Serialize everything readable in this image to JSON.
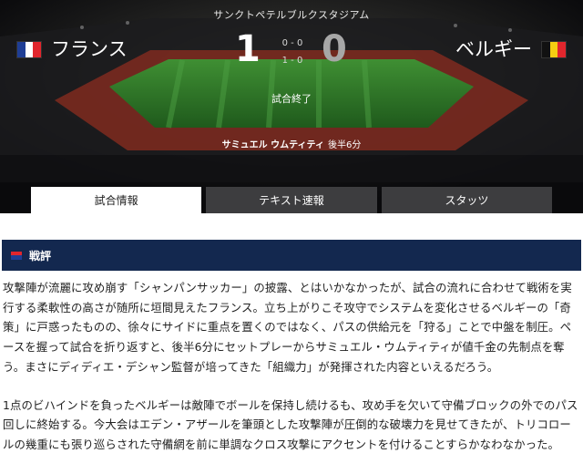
{
  "match": {
    "venue": "サンクトペテルブルクスタジアム",
    "home": {
      "name": "フランス",
      "score": "1",
      "flag_colors": [
        "#1f3e95",
        "#ffffff",
        "#e1262d"
      ]
    },
    "away": {
      "name": "ベルギー",
      "score": "0",
      "flag_colors": [
        "#111111",
        "#f5cd12",
        "#e1262d"
      ]
    },
    "first_half": "0 - 0",
    "second_half": "1 - 0",
    "status": "試合終了",
    "scorer": {
      "name": "サミュエル ウムティティ",
      "minute": "後半6分"
    }
  },
  "tabs": [
    {
      "label": "試合情報",
      "active": true
    },
    {
      "label": "テキスト速報",
      "active": false
    },
    {
      "label": "スタッツ",
      "active": false
    }
  ],
  "section": {
    "title": "戦評",
    "accent_colors": [
      "#e1262d",
      "#1f3e95"
    ]
  },
  "article": {
    "paragraphs": [
      "攻撃陣が流麗に攻め崩す「シャンパンサッカー」の披露、とはいかなかったが、試合の流れに合わせて戦術を実行する柔軟性の高さが随所に垣間見えたフランス。立ち上がりこそ攻守でシステムを変化させるベルギーの「奇策」に戸惑ったものの、徐々にサイドに重点を置くのではなく、パスの供給元を「狩る」ことで中盤を制圧。ペースを握って試合を折り返すと、後半6分にセットプレーからサミュエル・ウムティティが値千金の先制点を奪う。まさにディディエ・デシャン監督が培ってきた「組織力」が発揮された内容といえるだろう。",
      "1点のビハインドを負ったベルギーは敵陣でボールを保持し続けるも、攻め手を欠いて守備ブロックの外でのパス回しに終始する。今大会はエデン・アザールを筆頭とした攻撃陣が圧倒的な破壊力を見せてきたが、トリコロールの幾重にも張り巡らされた守備網を前に単調なクロス攻撃にアクセントを付けることすらかなわなかった。"
    ]
  },
  "colors": {
    "header_bg": "#0b0b0d",
    "section_bg": "#13284f",
    "pitch": "#2f7a2a",
    "tab_inactive": "#3d3d3f"
  }
}
